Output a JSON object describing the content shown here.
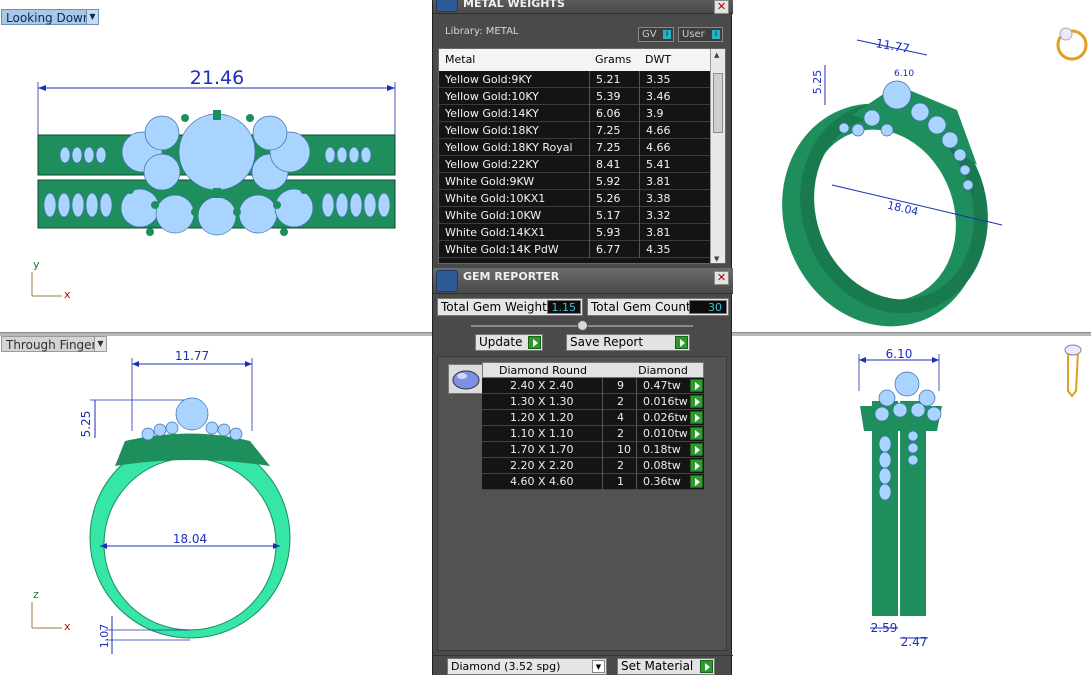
{
  "viewports": {
    "top_left": {
      "label": "Looking Down",
      "width_dim": "21.46",
      "axis_v": "y",
      "axis_h": "x"
    },
    "bottom_left": {
      "label": "Through Finger",
      "top_dim": "11.77",
      "height_dim": "5.25",
      "inner_dim": "18.04",
      "shank_dim": "1.07",
      "axis_v": "z",
      "axis_h": "x"
    },
    "top_right": {
      "top_dim": "11.77",
      "side_dim": "5.25",
      "head_dim": "6.10",
      "inner_dim": "18.04"
    },
    "bottom_right": {
      "top_dim": "6.10",
      "band_a": "2.59",
      "band_b": "2.47"
    }
  },
  "metal_weights": {
    "title": "METAL WEIGHTS",
    "library_label": "Library: METAL",
    "gv_label": "GV",
    "user_label": "User",
    "columns": [
      "Metal",
      "Grams",
      "DWT"
    ],
    "rows": [
      [
        "Yellow Gold:9KY",
        "5.21",
        "3.35"
      ],
      [
        "Yellow Gold:10KY",
        "5.39",
        "3.46"
      ],
      [
        "Yellow Gold:14KY",
        "6.06",
        "3.9"
      ],
      [
        "Yellow Gold:18KY",
        "7.25",
        "4.66"
      ],
      [
        "Yellow Gold:18KY Royal",
        "7.25",
        "4.66"
      ],
      [
        "Yellow Gold:22KY",
        "8.41",
        "5.41"
      ],
      [
        "White Gold:9KW",
        "5.92",
        "3.81"
      ],
      [
        "White Gold:10KX1",
        "5.26",
        "3.38"
      ],
      [
        "White Gold:10KW",
        "5.17",
        "3.32"
      ],
      [
        "White Gold:14KX1",
        "5.93",
        "3.81"
      ],
      [
        "White Gold:14K PdW",
        "6.77",
        "4.35"
      ]
    ]
  },
  "gem_reporter": {
    "title": "GEM REPORTER",
    "total_weight_label": "Total Gem Weight",
    "total_weight_value": "1.15",
    "total_count_label": "Total Gem Count",
    "total_count_value": "30",
    "update_label": "Update",
    "save_label": "Save Report",
    "col_shape": "Diamond Round",
    "col_type": "Diamond",
    "rows": [
      [
        "2.40 X 2.40",
        "9",
        "0.47tw"
      ],
      [
        "1.30 X 1.30",
        "2",
        "0.016tw"
      ],
      [
        "1.20 X 1.20",
        "4",
        "0.026tw"
      ],
      [
        "1.10 X 1.10",
        "2",
        "0.010tw"
      ],
      [
        "1.70 X 1.70",
        "10",
        "0.18tw"
      ],
      [
        "2.20 X 2.20",
        "2",
        "0.08tw"
      ],
      [
        "4.60 X 4.60",
        "1",
        "0.36tw"
      ]
    ],
    "material_select": "Diamond    (3.52 spg)",
    "set_material_label": "Set Material"
  },
  "colors": {
    "ring_green": "#1e8f5c",
    "ring_light": "#35e6a4",
    "gem_blue": "#a9d4ff",
    "dim_blue": "#1c2fb8"
  }
}
